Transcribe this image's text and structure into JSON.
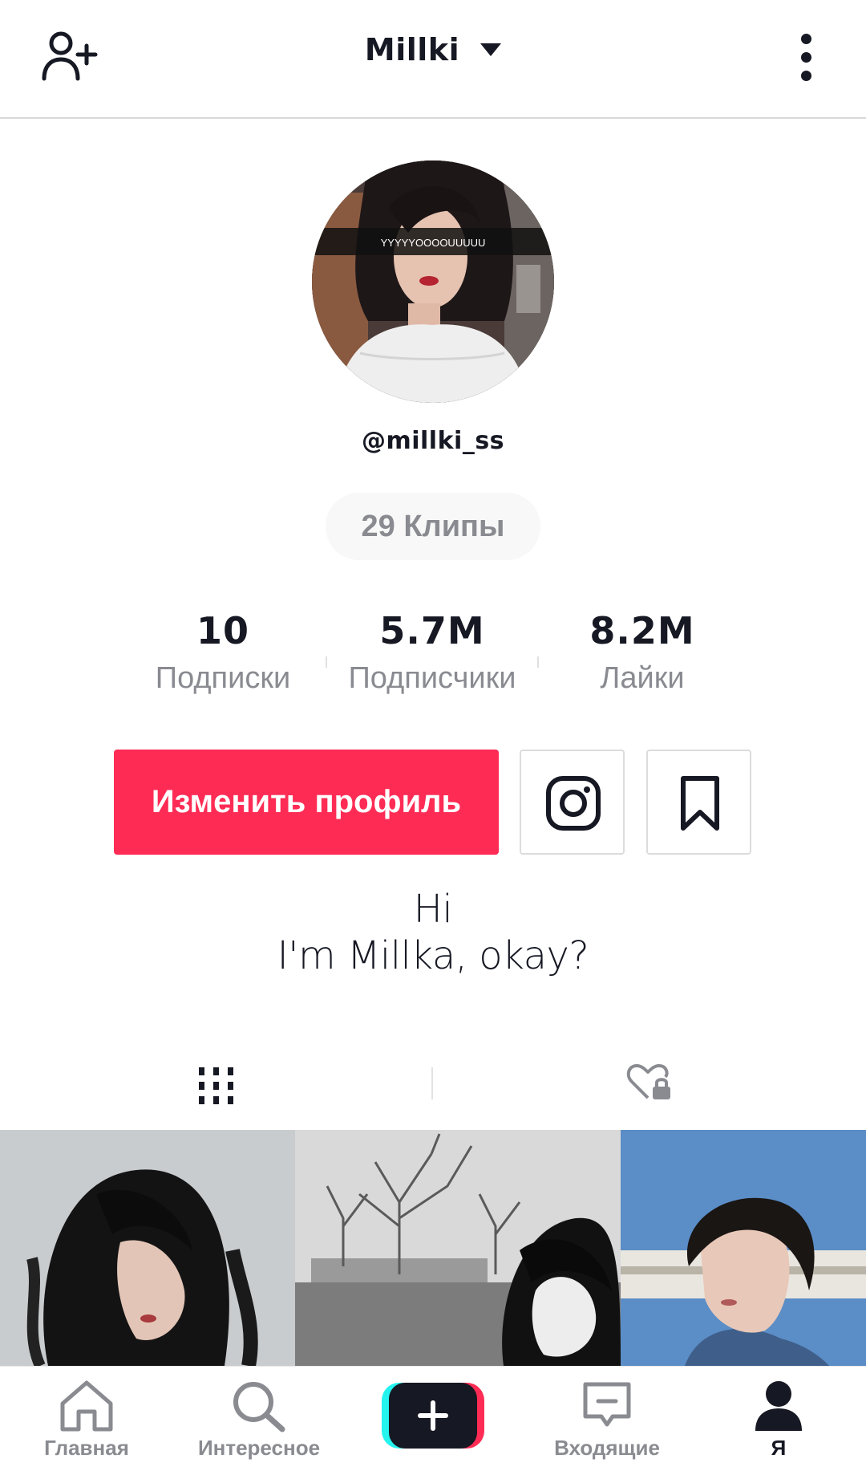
{
  "header": {
    "title": "Millki",
    "add_user_icon": "person-add-icon",
    "more_icon": "vertical-dots-icon"
  },
  "profile": {
    "avatar_caption": "YYYYYOOOOUUUUU",
    "username": "@millki_ss",
    "clips_count_label": "29 Клипы"
  },
  "stats": [
    {
      "value": "10",
      "label": "Подписки"
    },
    {
      "value": "5.7M",
      "label": "Подписчики"
    },
    {
      "value": "8.2M",
      "label": "Лайки"
    }
  ],
  "actions": {
    "edit_profile_label": "Изменить профиль",
    "instagram_icon": "instagram-icon",
    "bookmark_icon": "bookmark-icon",
    "accent_color": "#fe2c55"
  },
  "bio": {
    "line1": "Hi",
    "line2": "I'm Millka, okay?"
  },
  "tabs": [
    {
      "icon": "grid-icon",
      "active": true
    },
    {
      "icon": "liked-private-icon",
      "active": false
    }
  ],
  "videos": [
    {
      "thumbnail": "dark-haired-girl-portrait"
    },
    {
      "thumbnail": "black-white-girl-tree"
    },
    {
      "thumbnail": "girl-short-hair-sky"
    }
  ],
  "bottom_nav": [
    {
      "label": "Главная",
      "icon": "home-icon"
    },
    {
      "label": "Интересное",
      "icon": "search-icon"
    },
    {
      "label": "",
      "icon": "create-plus-icon"
    },
    {
      "label": "Входящие",
      "icon": "inbox-icon"
    },
    {
      "label": "Я",
      "icon": "profile-icon",
      "active": true
    }
  ]
}
